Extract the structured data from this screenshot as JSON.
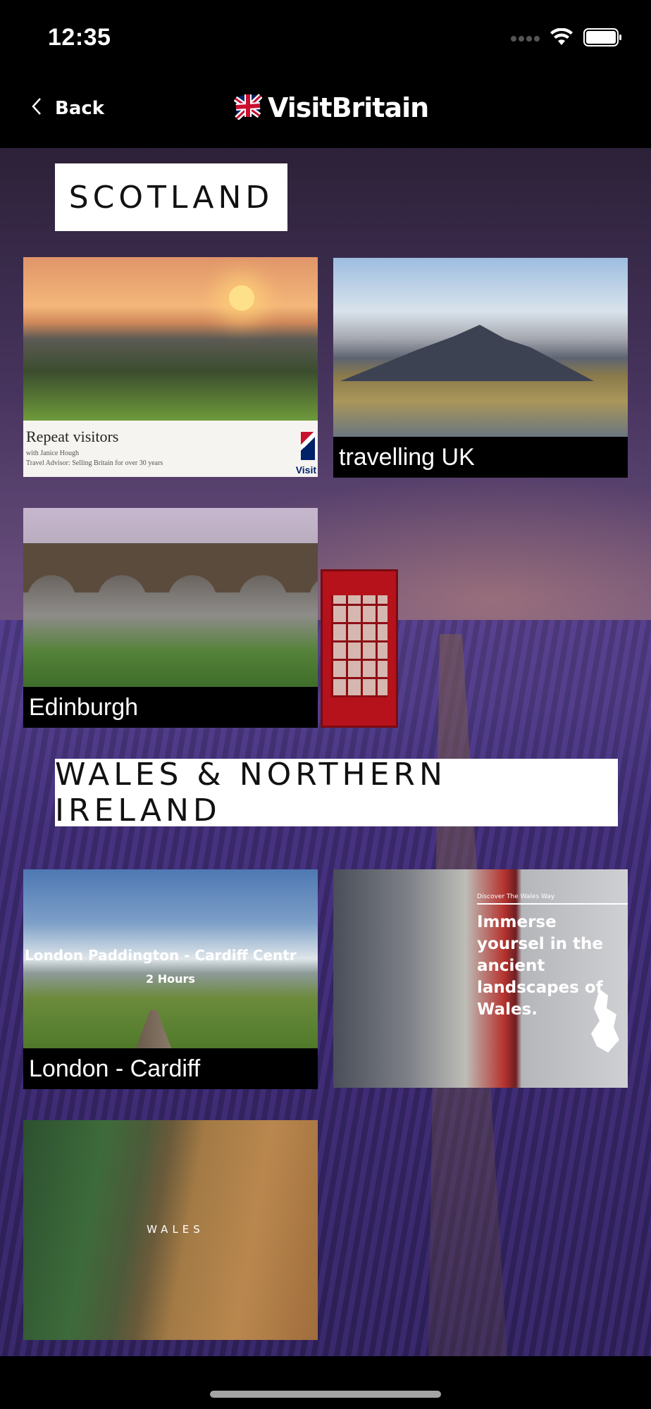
{
  "status_bar": {
    "time": "12:35"
  },
  "nav": {
    "back_label": "Back",
    "brand": "VisitBritain"
  },
  "sections": [
    {
      "title": "SCOTLAND",
      "tiles": [
        {
          "overlay_title": "Repeat visitors",
          "overlay_line1": "with Janice Hough",
          "overlay_line2": "Travel Advisor: Selling Britain for over 30 years",
          "overlay_logo": "Visit"
        },
        {
          "caption": "travelling UK"
        },
        {
          "caption": "Edinburgh"
        }
      ]
    },
    {
      "title": "WALES & NORTHERN IRELAND",
      "tiles": [
        {
          "overlay_line1": "London Paddington - Cardiff Centr",
          "overlay_line2": "2 Hours",
          "caption": "London - Cardiff"
        },
        {
          "overlay_small": "Discover The Wales Way",
          "overlay_text": "Immerse yoursel in the ancient landscapes of Wales."
        },
        {
          "overlay_text": "WALES"
        }
      ]
    }
  ]
}
